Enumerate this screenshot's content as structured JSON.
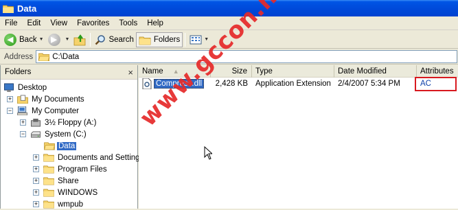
{
  "window": {
    "title": "Data"
  },
  "menu": {
    "items": [
      "File",
      "Edit",
      "View",
      "Favorites",
      "Tools",
      "Help"
    ]
  },
  "toolbar": {
    "back_label": "Back",
    "search_label": "Search",
    "folders_label": "Folders"
  },
  "address": {
    "label": "Address",
    "value": "C:\\Data"
  },
  "folders_pane": {
    "title": "Folders",
    "close_glyph": "×",
    "tree": [
      {
        "label": "Desktop",
        "icon": "desktop-icon",
        "indent": 0,
        "expander": ""
      },
      {
        "label": "My Documents",
        "icon": "my-documents-icon",
        "indent": 1,
        "expander": "+"
      },
      {
        "label": "My Computer",
        "icon": "my-computer-icon",
        "indent": 1,
        "expander": "−"
      },
      {
        "label": "3½ Floppy (A:)",
        "icon": "floppy-icon",
        "indent": 2,
        "expander": "+"
      },
      {
        "label": "System (C:)",
        "icon": "drive-icon",
        "indent": 2,
        "expander": "−"
      },
      {
        "label": "Data",
        "icon": "folder-open-icon",
        "indent": 3,
        "expander": "",
        "selected": true
      },
      {
        "label": "Documents and Settings",
        "icon": "folder-icon",
        "indent": 3,
        "expander": "+"
      },
      {
        "label": "Program Files",
        "icon": "folder-icon",
        "indent": 3,
        "expander": "+"
      },
      {
        "label": "Share",
        "icon": "folder-icon",
        "indent": 3,
        "expander": "+"
      },
      {
        "label": "WINDOWS",
        "icon": "folder-icon",
        "indent": 3,
        "expander": "+"
      },
      {
        "label": "wmpub",
        "icon": "folder-icon",
        "indent": 3,
        "expander": "+"
      }
    ]
  },
  "file_list": {
    "columns": [
      "Name",
      "Size",
      "Type",
      "Date Modified",
      "Attributes"
    ],
    "rows": [
      {
        "name": "Compress.dll",
        "size": "2,428 KB",
        "type": "Application Extension",
        "date": "2/4/2007 5:34 PM",
        "attributes": "AC"
      }
    ]
  },
  "watermark": {
    "text": "www.gccon.net"
  },
  "colors": {
    "titlebar": "#0048d8",
    "selection": "#316ac5",
    "highlight_box": "#d8191f",
    "watermark": "#e62a2a"
  }
}
